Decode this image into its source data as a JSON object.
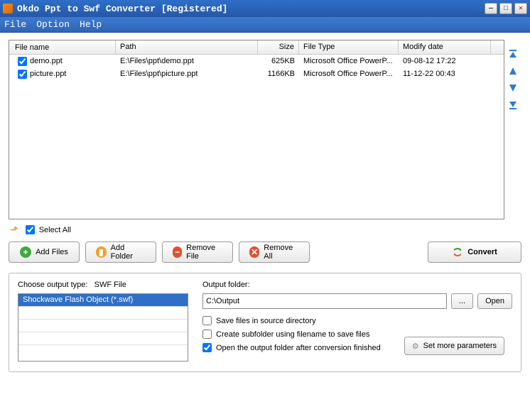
{
  "window": {
    "title": "Okdo Ppt to Swf Converter [Registered]"
  },
  "menu": {
    "file": "File",
    "option": "Option",
    "help": "Help"
  },
  "columns": {
    "name": "File name",
    "path": "Path",
    "size": "Size",
    "type": "File Type",
    "date": "Modify date"
  },
  "files": [
    {
      "name": "demo.ppt",
      "path": "E:\\Files\\ppt\\demo.ppt",
      "size": "625KB",
      "type": "Microsoft Office PowerP...",
      "date": "09-08-12 17:22"
    },
    {
      "name": "picture.ppt",
      "path": "E:\\Files\\ppt\\picture.ppt",
      "size": "1166KB",
      "type": "Microsoft Office PowerP...",
      "date": "11-12-22 00:43"
    }
  ],
  "selectAll": "Select All",
  "buttons": {
    "addFiles": "Add Files",
    "addFolder": "Add Folder",
    "removeFile": "Remove File",
    "removeAll": "Remove All",
    "convert": "Convert"
  },
  "outputType": {
    "label": "Choose output type:",
    "current": "SWF File",
    "options": [
      "Shockwave Flash Object (*.swf)"
    ]
  },
  "outputFolder": {
    "label": "Output folder:",
    "value": "C:\\Output",
    "browse": "...",
    "open": "Open"
  },
  "options": {
    "saveSource": "Save files in source directory",
    "createSub": "Create subfolder using filename to save files",
    "openAfter": "Open the output folder after conversion finished"
  },
  "moreParams": "Set more parameters"
}
